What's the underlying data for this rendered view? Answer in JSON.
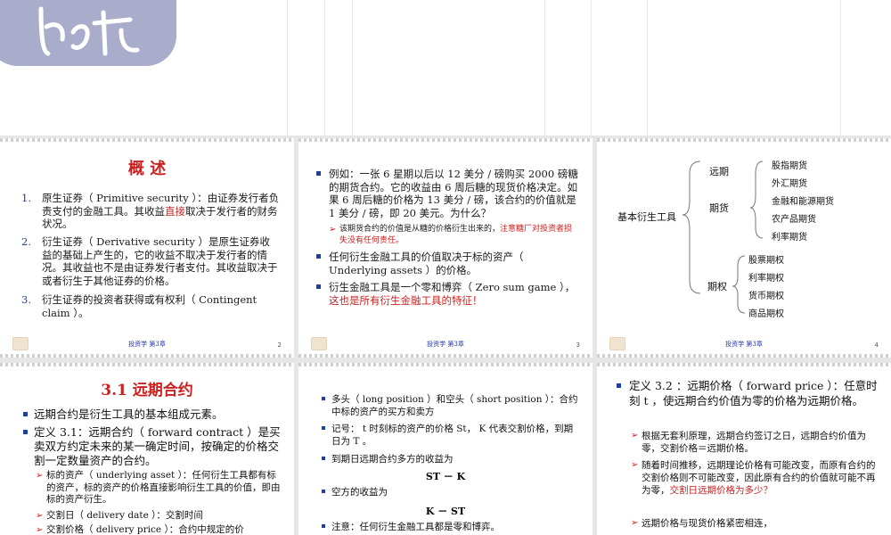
{
  "slides": {
    "s1": {
      "title": "概 述",
      "items": [
        {
          "num": "1.",
          "pre": "原生证券（ Primitive security ）：由证券发行者负责支付的金融工具。其收益",
          "red": "直接",
          "post": "取决于发行者的财务状况。"
        },
        {
          "num": "2.",
          "text": "衍生证券（ Derivative security ）是原生证券收益的基础上产生的，它的收益不取决于发行者的情况。其收益也不是由证券发行者支付。其收益取决于或者衍生于其他证券的价格。"
        },
        {
          "num": "3.",
          "text": "衍生证券的投资者获得或有权利（ Contingent claim ）。"
        }
      ],
      "footer": "投资学 第3章",
      "page": "2"
    },
    "s2": {
      "b1": "例如：一张 6 星期以后以 12 美分 / 磅购买 2000 磅糖的期货合约。它的收益由 6 周后糖的现货价格决定。如果 6 周后糖的价格为 13 美分 / 磅，该合约的价值就是 1 美分 / 磅，即 20 美元。为什么？",
      "sub_pre": "该期货合约的价值是从糖的价格衍生出来的，",
      "sub_red": "注意糖厂对投资者损失没有任何责任。",
      "b2": "任何衍生金融工具的价值取决于标的资产（ Underlying assets ）的价格。",
      "b3_pre": "衍生金融工具是一个零和博弈（ Zero sum game ），",
      "b3_red": "这也是所有衍生金融工具的特征！",
      "footer": "投资学 第3章",
      "page": "3"
    },
    "s3": {
      "root": "基本衍生工具",
      "branches": [
        "远期",
        "期货",
        "期权"
      ],
      "futures_leaves": [
        "股指期货",
        "外汇期货",
        "金融和能源期货",
        "农产品期货",
        "利率期货"
      ],
      "option_leaves": [
        "股票期权",
        "利率期权",
        "货币期权",
        "商品期权"
      ],
      "footer": "投资学 第3章",
      "page": "4"
    },
    "s4": {
      "title": "3.1 远期合约",
      "b1": "远期合约是衍生工具的基本组成元素。",
      "b2": "定义 3.1：远期合约（ forward contract ）是买卖双方约定未来的某一确定时间，按确定的价格交割一定数量资产的合约。",
      "subs": [
        "标的资产（ underlying asset ）：任何衍生工具都有标的资产，标的资产的价格直接影响衍生工具的价值，即由标的资产衍生。",
        "交割日（ delivery date ）：交割时间",
        "交割价格（ delivery price ）：合约中规定的价"
      ]
    },
    "s5": {
      "b1": "多头（ long position ）和空头（ short position ）：合约中标的资产的买方和卖方",
      "b2": "记号： t 时刻标的资产的价格 St， K 代表交割价格，到期日为 T 。",
      "b3": "到期日远期合约多方的收益为",
      "f1": "ST － K",
      "b4": "空方的收益为",
      "f2": "K － ST",
      "b5": "注意：任何衍生金融工具都是零和博弈。"
    },
    "s6": {
      "b1": "定义 3.2 ：远期价格（ forward price ）：任意时刻 t ，使远期合约价值为零的价格为远期价格。",
      "sub1": "根据无套利原理，远期合约签订之日，远期合约价值为零，交割价格＝远期价格。",
      "sub2_pre": "随着时间推移，远期理论价格有可能改变，而原有合约的交割价格则不可能改变，因此原有合约的价值就可能不再为零，",
      "sub2_red": "交割日远期价格为多少？",
      "sub3": "远期价格与现货价格紧密相连，"
    }
  }
}
